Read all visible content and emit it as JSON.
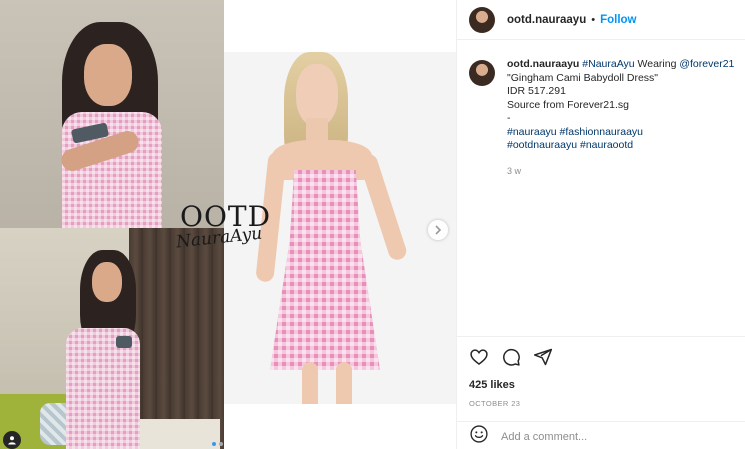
{
  "post": {
    "header": {
      "username": "ootd.nauraayu",
      "separator": "•",
      "follow_label": "Follow"
    },
    "media": {
      "watermark_title": "OOTD",
      "watermark_script": "NauraAyu",
      "next_icon": "chevron-right-icon",
      "tag_icon": "user-tag-icon",
      "carousel_dots": 2,
      "active_dot": 0
    },
    "caption": {
      "username": "ootd.nauraayu",
      "lines": [
        {
          "prefix_hashtag": "#NauraAyu",
          "text": " Wearing ",
          "mention": "@forever21"
        },
        "\"Gingham Cami Babydoll Dress\"",
        "IDR 517.291",
        "Source from Forever21.sg",
        "-"
      ],
      "hashtags_line1": "#nauraayu #fashionnauraayu",
      "hashtags_line2": "#ootdnauraayu #nauraootd",
      "time": "3 w"
    },
    "actions": {
      "like_icon": "heart-icon",
      "comment_icon": "comment-icon",
      "share_icon": "share-icon",
      "likes": "425 likes",
      "date": "OCTOBER 23"
    },
    "comment": {
      "emoji_icon": "emoji-icon",
      "placeholder": "Add a comment..."
    }
  }
}
